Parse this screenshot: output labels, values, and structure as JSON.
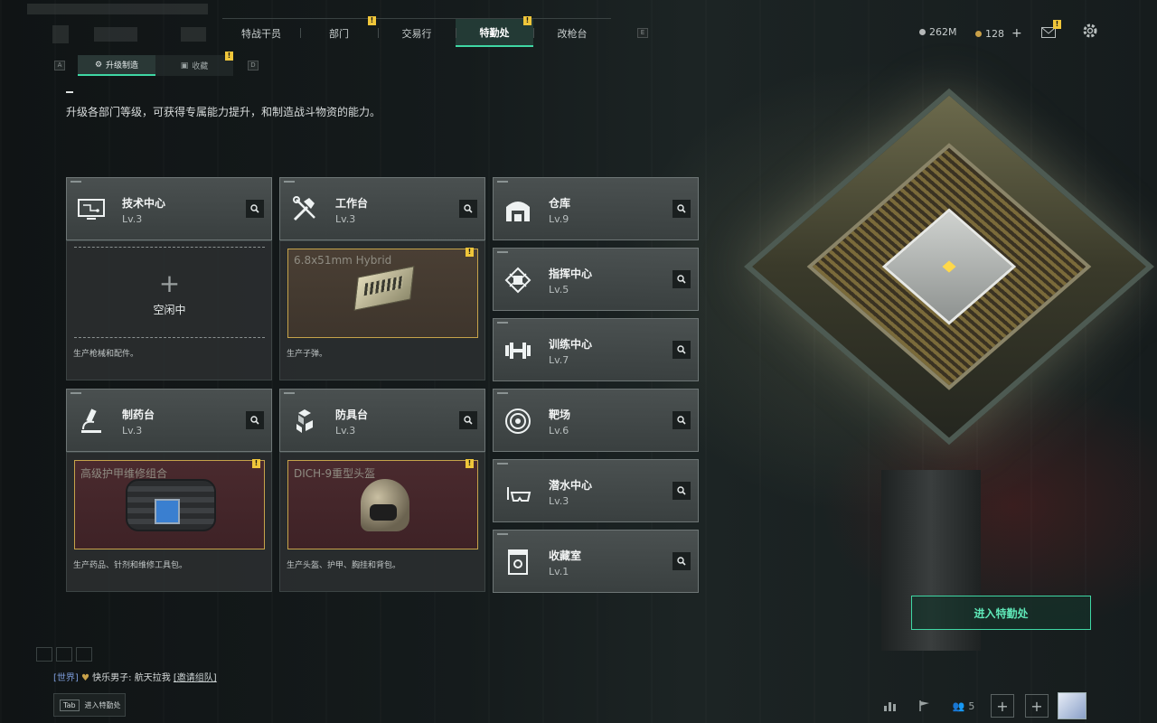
{
  "nav": {
    "tabs": [
      {
        "label": "特战干员",
        "active": false,
        "warning": false
      },
      {
        "label": "部门",
        "active": false,
        "warning": true
      },
      {
        "label": "交易行",
        "active": false,
        "warning": false
      },
      {
        "label": "特勤处",
        "active": true,
        "warning": true
      },
      {
        "label": "改枪台",
        "active": false,
        "warning": false
      }
    ],
    "key_right": "E",
    "key_left": "Q"
  },
  "currency": {
    "coins": "262M",
    "premium": "128",
    "add": "+"
  },
  "subtabs": [
    {
      "label": "升级制造",
      "active": true,
      "key": "A"
    },
    {
      "label": "收藏",
      "active": false,
      "key": "D"
    }
  ],
  "description": "升级各部门等级，可获得专属能力提升，和制造战斗物资的能力。",
  "facilities_left": [
    {
      "name": "技术中心",
      "level": "Lv.3",
      "icon": "monitor-icon",
      "panel": {
        "type": "idle",
        "plus": "+",
        "label": "空闲中",
        "desc": "生产枪械和配件。"
      }
    },
    {
      "name": "工作台",
      "level": "Lv.3",
      "icon": "tools-icon",
      "panel": {
        "type": "product",
        "item": "6.8x51mm Hybrid",
        "color": "brown",
        "desc": "生产子弹。"
      }
    },
    {
      "name": "制药台",
      "level": "Lv.3",
      "icon": "microscope-icon",
      "panel": {
        "type": "product",
        "item": "高级护甲维修组合",
        "color": "red",
        "desc": "生产药品、针剂和维修工具包。"
      }
    },
    {
      "name": "防具台",
      "level": "Lv.3",
      "icon": "armor-cubes-icon",
      "panel": {
        "type": "product",
        "item": "DICH-9重型头盔",
        "color": "red",
        "desc": "生产头盔、护甲、胸挂和背包。"
      }
    }
  ],
  "facilities_right": [
    {
      "name": "仓库",
      "level": "Lv.9",
      "icon": "warehouse-icon"
    },
    {
      "name": "指挥中心",
      "level": "Lv.5",
      "icon": "chip-icon"
    },
    {
      "name": "训练中心",
      "level": "Lv.7",
      "icon": "dumbbell-icon"
    },
    {
      "name": "靶场",
      "level": "Lv.6",
      "icon": "target-icon"
    },
    {
      "name": "潜水中心",
      "level": "Lv.3",
      "icon": "diving-mask-icon"
    },
    {
      "name": "收藏室",
      "level": "Lv.1",
      "icon": "collection-icon"
    }
  ],
  "enter_button": "进入特勤处",
  "chat": {
    "channel": "[世界]",
    "user": "快乐男子",
    "message": "航天拉我",
    "invite": "[邀请组队]"
  },
  "tab_hint": {
    "key": "Tab",
    "label": "进入特勤处"
  },
  "bottom_bar": {
    "friends_count": "5"
  },
  "colors": {
    "accent": "#3fd7a4",
    "warning": "#f0c63a",
    "product_border": "#c6a34a"
  }
}
